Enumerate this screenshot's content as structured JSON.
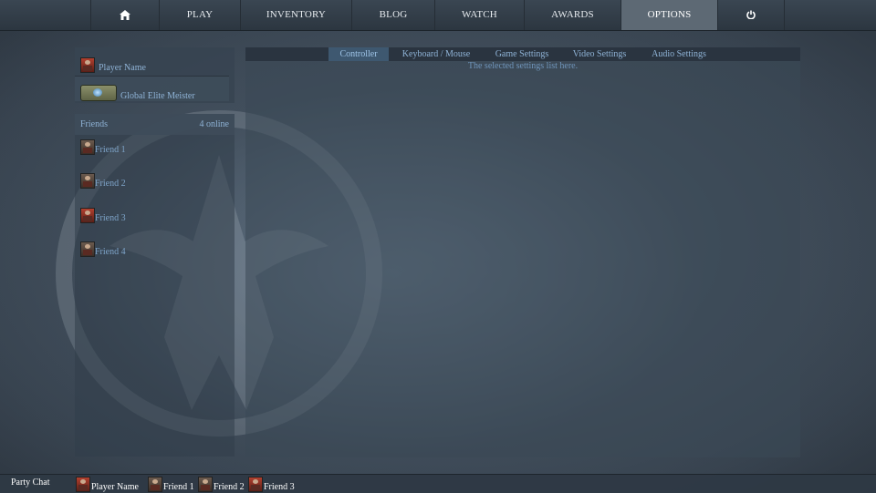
{
  "nav": {
    "home_icon": "home-icon",
    "items": [
      {
        "label": "PLAY"
      },
      {
        "label": "INVENTORY"
      },
      {
        "label": "BLOG"
      },
      {
        "label": "WATCH"
      },
      {
        "label": "AWARDS"
      },
      {
        "label": "OPTIONS",
        "active": true
      }
    ],
    "power_icon": "power-icon"
  },
  "profile": {
    "player_name": "Player Name",
    "rank": "Global Elite Meister"
  },
  "friends": {
    "title": "Friends",
    "online": "4 online",
    "items": [
      {
        "name": "Friend 1"
      },
      {
        "name": "Friend 2"
      },
      {
        "name": "Friend 3"
      },
      {
        "name": "Friend 4"
      }
    ]
  },
  "settings": {
    "tabs": [
      {
        "label": "Controller",
        "active": true
      },
      {
        "label": "Keyboard / Mouse"
      },
      {
        "label": "Game Settings"
      },
      {
        "label": "Video Settings"
      },
      {
        "label": "Audio Settings"
      }
    ],
    "message": "The selected settings list here."
  },
  "party": {
    "label": "Party Chat",
    "members": [
      {
        "name": "Player Name"
      },
      {
        "name": "Friend 1"
      },
      {
        "name": "Friend 2"
      },
      {
        "name": "Friend 3"
      }
    ]
  },
  "colors": {
    "accent_text": "#8fb3d6",
    "active_nav": "#5d6974",
    "active_tab": "#3e5870"
  }
}
